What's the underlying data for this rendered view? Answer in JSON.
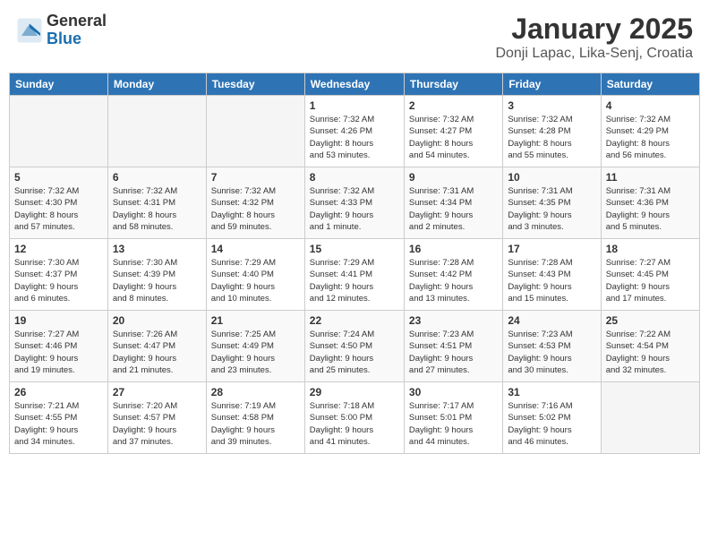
{
  "header": {
    "logo_general": "General",
    "logo_blue": "Blue",
    "title": "January 2025",
    "location": "Donji Lapac, Lika-Senj, Croatia"
  },
  "weekdays": [
    "Sunday",
    "Monday",
    "Tuesday",
    "Wednesday",
    "Thursday",
    "Friday",
    "Saturday"
  ],
  "weeks": [
    [
      {
        "day": "",
        "info": ""
      },
      {
        "day": "",
        "info": ""
      },
      {
        "day": "",
        "info": ""
      },
      {
        "day": "1",
        "info": "Sunrise: 7:32 AM\nSunset: 4:26 PM\nDaylight: 8 hours\nand 53 minutes."
      },
      {
        "day": "2",
        "info": "Sunrise: 7:32 AM\nSunset: 4:27 PM\nDaylight: 8 hours\nand 54 minutes."
      },
      {
        "day": "3",
        "info": "Sunrise: 7:32 AM\nSunset: 4:28 PM\nDaylight: 8 hours\nand 55 minutes."
      },
      {
        "day": "4",
        "info": "Sunrise: 7:32 AM\nSunset: 4:29 PM\nDaylight: 8 hours\nand 56 minutes."
      }
    ],
    [
      {
        "day": "5",
        "info": "Sunrise: 7:32 AM\nSunset: 4:30 PM\nDaylight: 8 hours\nand 57 minutes."
      },
      {
        "day": "6",
        "info": "Sunrise: 7:32 AM\nSunset: 4:31 PM\nDaylight: 8 hours\nand 58 minutes."
      },
      {
        "day": "7",
        "info": "Sunrise: 7:32 AM\nSunset: 4:32 PM\nDaylight: 8 hours\nand 59 minutes."
      },
      {
        "day": "8",
        "info": "Sunrise: 7:32 AM\nSunset: 4:33 PM\nDaylight: 9 hours\nand 1 minute."
      },
      {
        "day": "9",
        "info": "Sunrise: 7:31 AM\nSunset: 4:34 PM\nDaylight: 9 hours\nand 2 minutes."
      },
      {
        "day": "10",
        "info": "Sunrise: 7:31 AM\nSunset: 4:35 PM\nDaylight: 9 hours\nand 3 minutes."
      },
      {
        "day": "11",
        "info": "Sunrise: 7:31 AM\nSunset: 4:36 PM\nDaylight: 9 hours\nand 5 minutes."
      }
    ],
    [
      {
        "day": "12",
        "info": "Sunrise: 7:30 AM\nSunset: 4:37 PM\nDaylight: 9 hours\nand 6 minutes."
      },
      {
        "day": "13",
        "info": "Sunrise: 7:30 AM\nSunset: 4:39 PM\nDaylight: 9 hours\nand 8 minutes."
      },
      {
        "day": "14",
        "info": "Sunrise: 7:29 AM\nSunset: 4:40 PM\nDaylight: 9 hours\nand 10 minutes."
      },
      {
        "day": "15",
        "info": "Sunrise: 7:29 AM\nSunset: 4:41 PM\nDaylight: 9 hours\nand 12 minutes."
      },
      {
        "day": "16",
        "info": "Sunrise: 7:28 AM\nSunset: 4:42 PM\nDaylight: 9 hours\nand 13 minutes."
      },
      {
        "day": "17",
        "info": "Sunrise: 7:28 AM\nSunset: 4:43 PM\nDaylight: 9 hours\nand 15 minutes."
      },
      {
        "day": "18",
        "info": "Sunrise: 7:27 AM\nSunset: 4:45 PM\nDaylight: 9 hours\nand 17 minutes."
      }
    ],
    [
      {
        "day": "19",
        "info": "Sunrise: 7:27 AM\nSunset: 4:46 PM\nDaylight: 9 hours\nand 19 minutes."
      },
      {
        "day": "20",
        "info": "Sunrise: 7:26 AM\nSunset: 4:47 PM\nDaylight: 9 hours\nand 21 minutes."
      },
      {
        "day": "21",
        "info": "Sunrise: 7:25 AM\nSunset: 4:49 PM\nDaylight: 9 hours\nand 23 minutes."
      },
      {
        "day": "22",
        "info": "Sunrise: 7:24 AM\nSunset: 4:50 PM\nDaylight: 9 hours\nand 25 minutes."
      },
      {
        "day": "23",
        "info": "Sunrise: 7:23 AM\nSunset: 4:51 PM\nDaylight: 9 hours\nand 27 minutes."
      },
      {
        "day": "24",
        "info": "Sunrise: 7:23 AM\nSunset: 4:53 PM\nDaylight: 9 hours\nand 30 minutes."
      },
      {
        "day": "25",
        "info": "Sunrise: 7:22 AM\nSunset: 4:54 PM\nDaylight: 9 hours\nand 32 minutes."
      }
    ],
    [
      {
        "day": "26",
        "info": "Sunrise: 7:21 AM\nSunset: 4:55 PM\nDaylight: 9 hours\nand 34 minutes."
      },
      {
        "day": "27",
        "info": "Sunrise: 7:20 AM\nSunset: 4:57 PM\nDaylight: 9 hours\nand 37 minutes."
      },
      {
        "day": "28",
        "info": "Sunrise: 7:19 AM\nSunset: 4:58 PM\nDaylight: 9 hours\nand 39 minutes."
      },
      {
        "day": "29",
        "info": "Sunrise: 7:18 AM\nSunset: 5:00 PM\nDaylight: 9 hours\nand 41 minutes."
      },
      {
        "day": "30",
        "info": "Sunrise: 7:17 AM\nSunset: 5:01 PM\nDaylight: 9 hours\nand 44 minutes."
      },
      {
        "day": "31",
        "info": "Sunrise: 7:16 AM\nSunset: 5:02 PM\nDaylight: 9 hours\nand 46 minutes."
      },
      {
        "day": "",
        "info": ""
      }
    ]
  ]
}
